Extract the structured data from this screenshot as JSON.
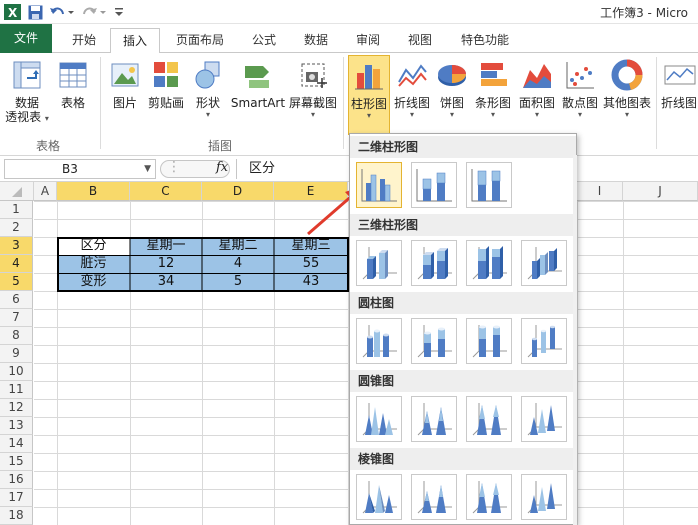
{
  "title_bar": {
    "title": "工作簿3 - Micro"
  },
  "tabs": [
    {
      "label": "文件"
    },
    {
      "label": "开始"
    },
    {
      "label": "插入"
    },
    {
      "label": "页面布局"
    },
    {
      "label": "公式"
    },
    {
      "label": "数据"
    },
    {
      "label": "审阅"
    },
    {
      "label": "视图"
    },
    {
      "label": "特色功能"
    }
  ],
  "active_tab": "插入",
  "ribbon": {
    "pivot_label_1": "数据",
    "pivot_label_2": "透视表",
    "table_label": "表格",
    "picture_label": "图片",
    "clipart_label": "剪贴画",
    "shapes_label": "形状",
    "smartart_label": "SmartArt",
    "screenshot_label": "屏幕截图",
    "column_label": "柱形图",
    "line_label": "折线图",
    "pie_label": "饼图",
    "bar_label": "条形图",
    "area_label": "面积图",
    "scatter_label": "散点图",
    "other_label": "其他图表",
    "sparkline_label": "折线图",
    "group_tables": "表格",
    "group_illustrations": "插图"
  },
  "formula_bar": {
    "name_box": "B3",
    "fx": "fx",
    "content": "区分"
  },
  "grid": {
    "columns": [
      "A",
      "B",
      "C",
      "D",
      "E",
      "I",
      "J"
    ],
    "rows": [
      "1",
      "2",
      "3",
      "4",
      "5",
      "6",
      "7",
      "8",
      "9",
      "10",
      "11",
      "12",
      "13",
      "14",
      "15",
      "16",
      "17",
      "18"
    ],
    "table": [
      [
        "区分",
        "星期一",
        "星期二",
        "星期三"
      ],
      [
        "脏污",
        "12",
        "4",
        "55"
      ],
      [
        "变形",
        "34",
        "5",
        "43"
      ]
    ]
  },
  "dropdown": {
    "sections": [
      {
        "title": "二维柱形图"
      },
      {
        "title": "三维柱形图"
      },
      {
        "title": "圆柱图"
      },
      {
        "title": "圆锥图"
      },
      {
        "title": "棱锥图"
      }
    ]
  },
  "colors": {
    "file_tab": "#1f7244",
    "selected_header": "#f8d96a",
    "table_fill": "#9cc3e6",
    "arrow": "#e03b2c",
    "chart_bar": "#4f7cc4"
  }
}
